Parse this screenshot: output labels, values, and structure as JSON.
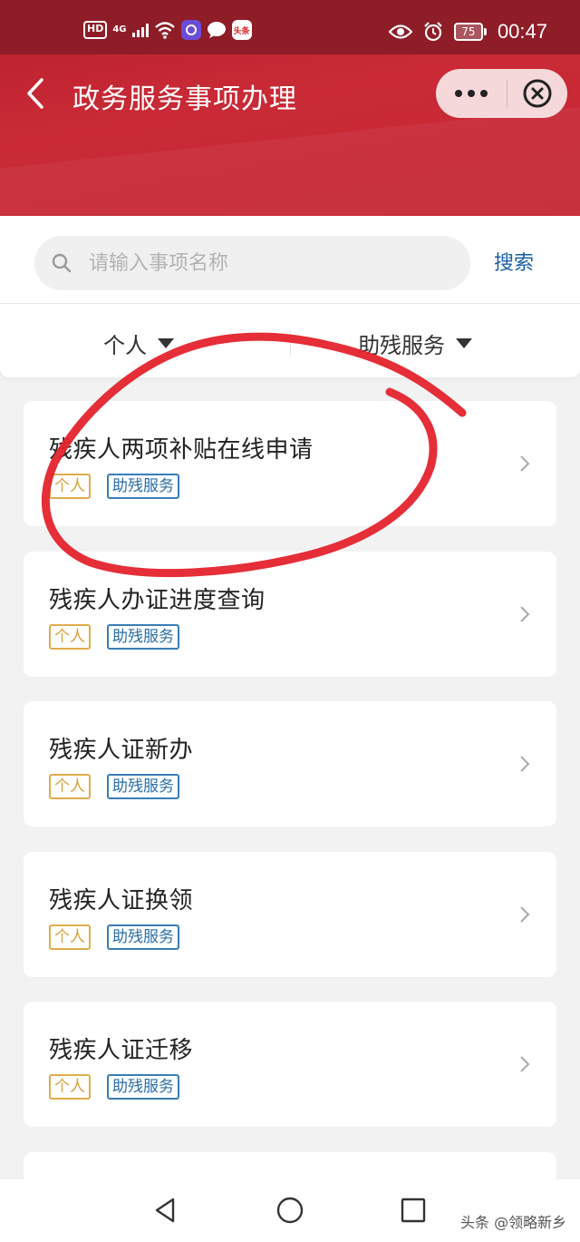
{
  "status_bar": {
    "hd": "HD",
    "network": "4G",
    "app_badge": "头条",
    "battery": "75",
    "time": "00:47"
  },
  "header": {
    "title": "政务服务事项办理"
  },
  "search": {
    "placeholder": "请输入事项名称",
    "value": "",
    "button_label": "搜索"
  },
  "filters": [
    {
      "label": "个人"
    },
    {
      "label": "助残服务"
    }
  ],
  "items": [
    {
      "title": "残疾人两项补贴在线申请",
      "tags": [
        "个人",
        "助残服务"
      ]
    },
    {
      "title": "残疾人办证进度查询",
      "tags": [
        "个人",
        "助残服务"
      ]
    },
    {
      "title": "残疾人证新办",
      "tags": [
        "个人",
        "助残服务"
      ]
    },
    {
      "title": "残疾人证换领",
      "tags": [
        "个人",
        "助残服务"
      ]
    },
    {
      "title": "残疾人证迁移",
      "tags": [
        "个人",
        "助残服务"
      ]
    }
  ],
  "watermark": "头条 @领略新乡",
  "colors": {
    "header_red": "#c52633",
    "statusbar": "#8e1d28",
    "search_link": "#1a5fa6",
    "tag_person": "#d8a13a",
    "tag_service": "#2a6ea8",
    "annotation": "#e4232c"
  }
}
